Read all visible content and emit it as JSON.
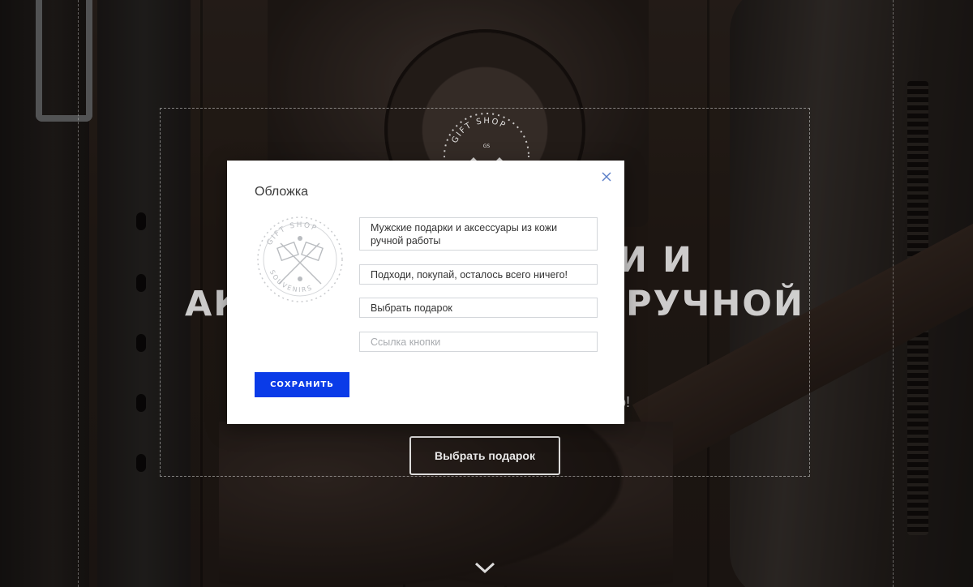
{
  "hero": {
    "title_line1_fragment": "И И",
    "title_line2_left": "АК",
    "title_line2_right": "РУЧНОЙ",
    "subtitle_fragment": "о!",
    "button_label": "Выбрать подарок"
  },
  "background_logo": {
    "text": "GIFT SHOP",
    "monogram": "GS"
  },
  "modal": {
    "title": "Обложка",
    "logo_text_top": "GIFT SHOP",
    "logo_text_bottom": "SOUVENIRS",
    "fields": {
      "title_value": "Мужские подарки и аксессуары из кожи ручной работы",
      "subtitle_value": "Подходи, покупай, осталось всего ничего!",
      "button_text_value": "Выбрать подарок",
      "button_link_placeholder": "Ссылка кнопки"
    },
    "save_label": "СОХРАНИТЬ",
    "close_icon": "close-icon"
  },
  "colors": {
    "accent": "#0a3be8",
    "modal_bg": "#ffffff",
    "field_border": "#d3d6da",
    "close_icon": "#5b7fc8"
  }
}
